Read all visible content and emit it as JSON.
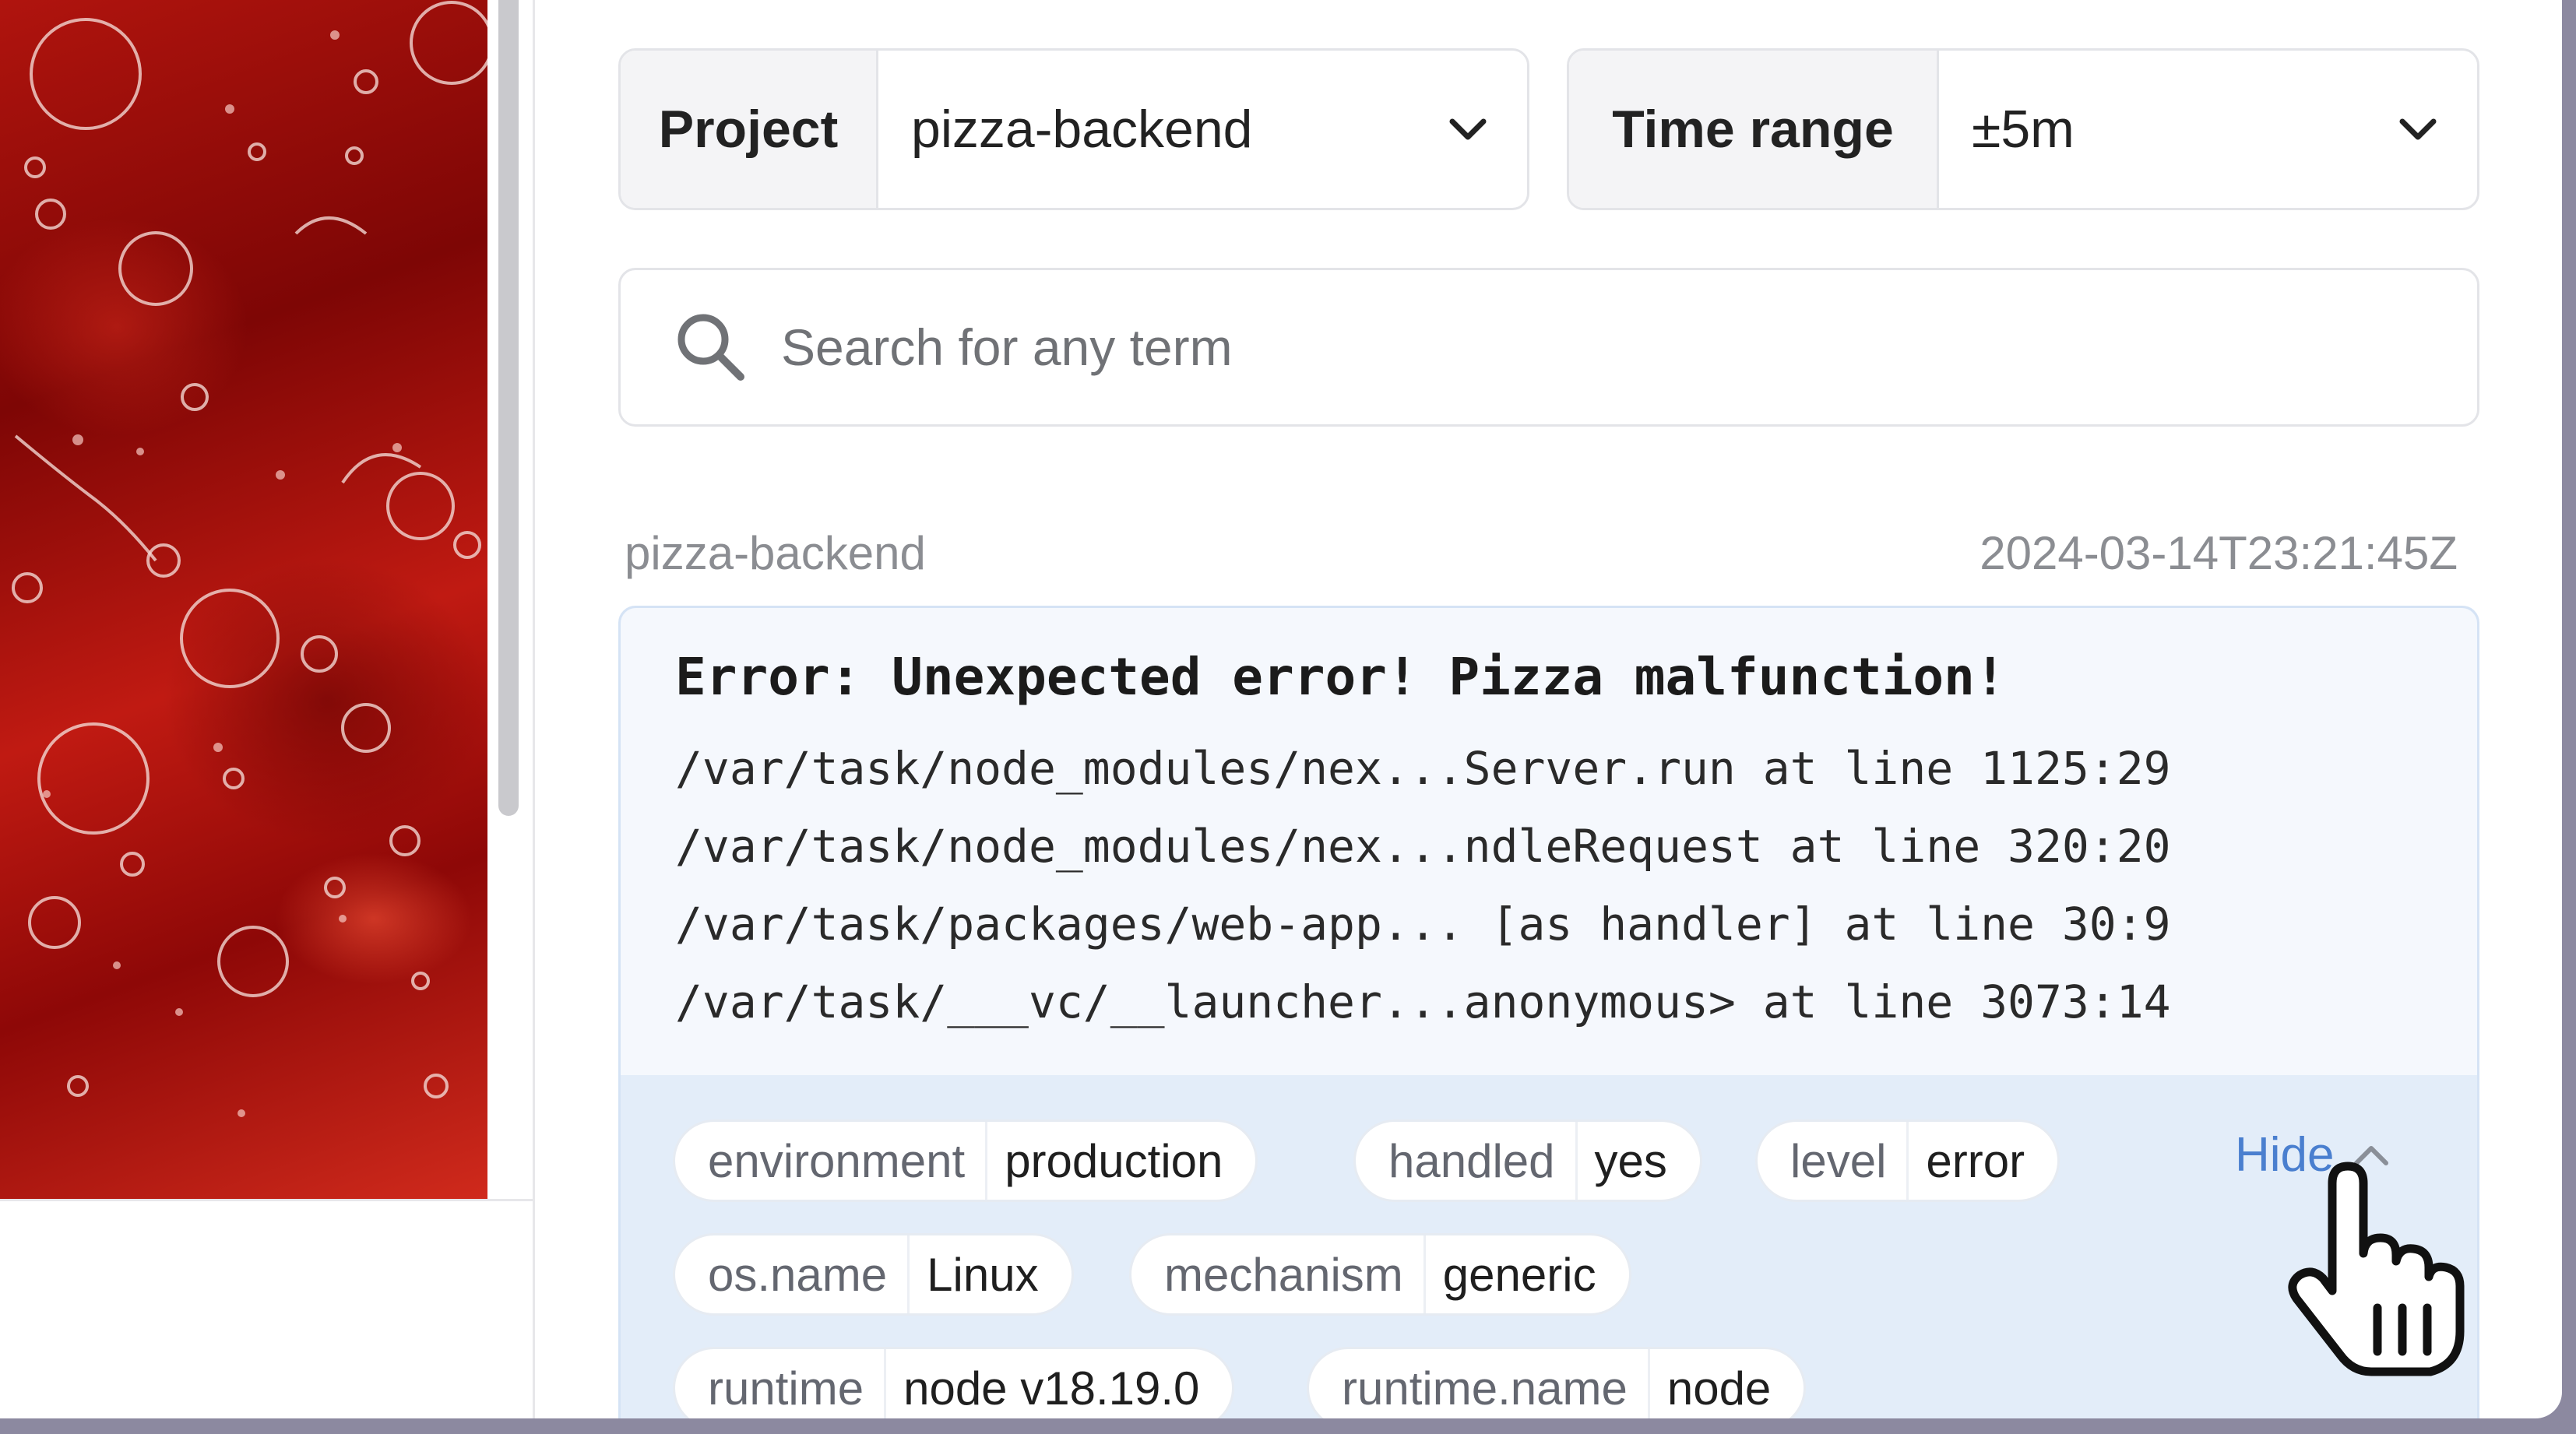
{
  "filters": {
    "project": {
      "label": "Project",
      "value": "pizza-backend"
    },
    "time_range": {
      "label": "Time range",
      "value": "±5m"
    }
  },
  "search": {
    "placeholder": "Search for any term",
    "value": ""
  },
  "event": {
    "project": "pizza-backend",
    "timestamp": "2024-03-14T23:21:45Z",
    "error_title": "Error: Unexpected error! Pizza malfunction!",
    "stack_frames": [
      "/var/task/node_modules/nex...Server.run at line 1125:29",
      "/var/task/node_modules/nex...ndleRequest at line 320:20",
      "/var/task/packages/web-app... [as handler] at line 30:9",
      "/var/task/___vc/__launcher...anonymous> at line 3073:14"
    ],
    "tags": [
      {
        "key": "environment",
        "value": "production"
      },
      {
        "key": "handled",
        "value": "yes"
      },
      {
        "key": "level",
        "value": "error"
      },
      {
        "key": "os.name",
        "value": "Linux"
      },
      {
        "key": "mechanism",
        "value": "generic"
      },
      {
        "key": "runtime",
        "value": "node v18.19.0"
      },
      {
        "key": "runtime.name",
        "value": "node"
      }
    ],
    "toggle_label": "Hide"
  },
  "icons": {
    "search": "search-icon",
    "dropdown": "chevron-down-icon",
    "collapse": "chevron-up-icon",
    "cursor": "hand-pointer-cursor"
  },
  "colors": {
    "link": "#4a7fcf",
    "card_background": "#e3edf9",
    "trace_background": "#f5f8fd"
  }
}
